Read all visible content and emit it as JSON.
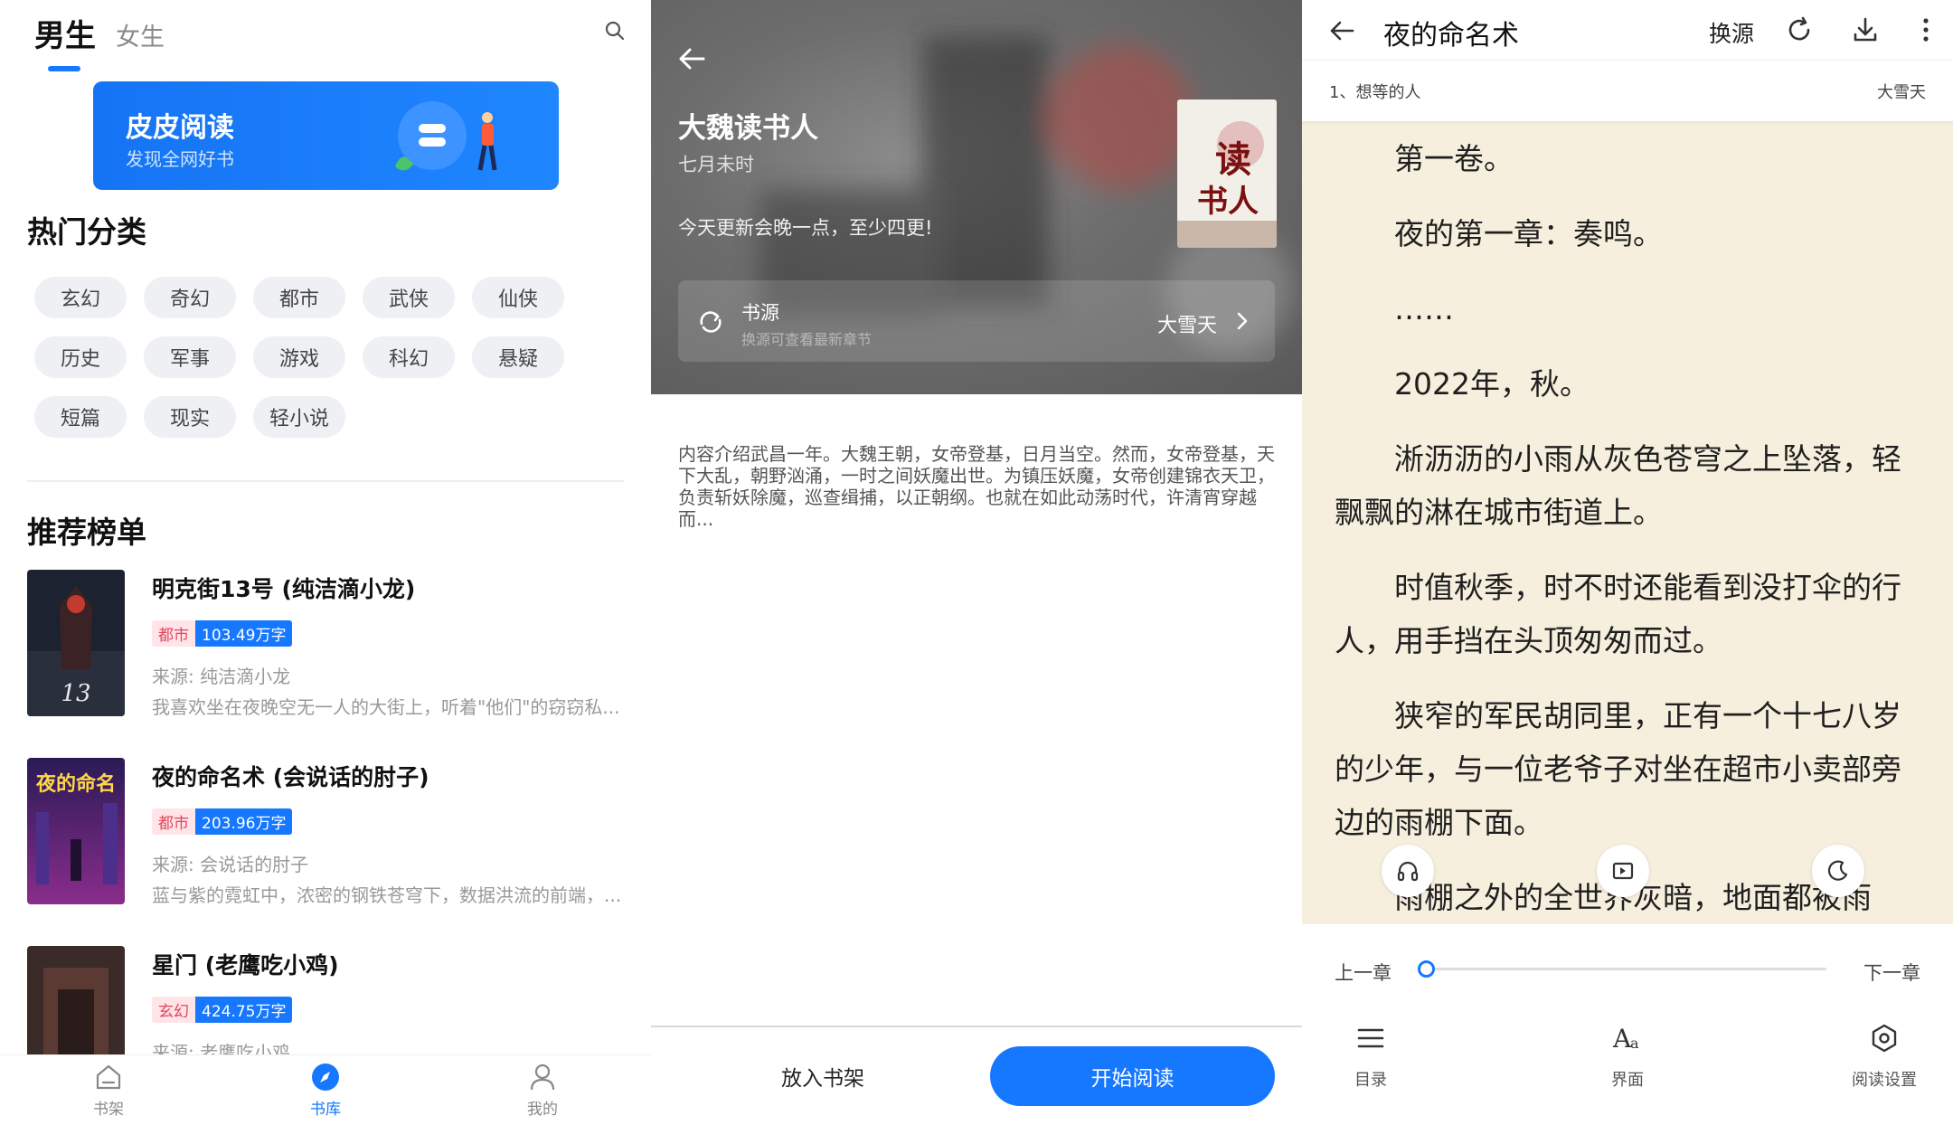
{
  "panel1": {
    "tabs": [
      "男生",
      "女生"
    ],
    "banner": {
      "title": "皮皮阅读",
      "subtitle": "发现全网好书"
    },
    "hot_title": "热门分类",
    "categories": [
      "玄幻",
      "奇幻",
      "都市",
      "武侠",
      "仙侠",
      "历史",
      "军事",
      "游戏",
      "科幻",
      "悬疑",
      "短篇",
      "现实",
      "轻小说"
    ],
    "rank_title": "推荐榜单",
    "books": [
      {
        "title": "明克街13号 (纯洁滴小龙)",
        "category": "都市",
        "length": "103.49万字",
        "source": "来源: 纯洁滴小龙",
        "desc": "我喜欢坐在夜晚空无一人的大街上，听着\"他们\"的窃窃私..."
      },
      {
        "title": "夜的命名术 (会说话的肘子)",
        "category": "都市",
        "length": "203.96万字",
        "source": "来源: 会说话的肘子",
        "desc": "蓝与紫的霓虹中，浓密的钢铁苍穹下，数据洪流的前端，..."
      },
      {
        "title": "星门 (老鹰吃小鸡)",
        "category": "玄幻",
        "length": "424.75万字",
        "source": "来源: 老鹰吃小鸡",
        "desc": ""
      }
    ],
    "nav": [
      "书架",
      "书库",
      "我的"
    ],
    "active_nav": "书库"
  },
  "panel2": {
    "book_title": "大魏读书人",
    "author": "七月未时",
    "notice": "今天更新会晚一点，至少四更!",
    "source_label": "书源",
    "source_hint": "换源可查看最新章节",
    "source_value": "大雪天",
    "intro": "内容介绍武昌一年。大魏王朝，女帝登基，日月当空。然而，女帝登基，天下大乱，朝野汹涌，一时之间妖魔出世。为镇压妖魔，女帝创建锦衣天卫，负责斩妖除魔，巡查缉捕，以正朝纲。也就在如此动荡时代，许清宵穿越而...",
    "shelf_button": "放入书架",
    "read_button": "开始阅读"
  },
  "panel3": {
    "title": "夜的命名术",
    "swap_label": "换源",
    "chapter": "1、想等的人",
    "source": "大雪天",
    "paragraphs": [
      "第一卷。",
      "夜的第一章：奏鸣。",
      "……",
      "2022年，秋。",
      "淅沥沥的小雨从灰色苍穹之上坠落，轻飘飘的淋在城市街道上。",
      "时值秋季，时不时还能看到没打伞的行人，用手挡在头顶匆匆而过。",
      "狭窄的军民胡同里，正有一个十七八岁的少年，与一位老爷子对坐在超市小卖部旁边的雨棚下面。",
      "雨棚之外的全世界灰暗，地面都被雨"
    ],
    "prev_chapter": "上一章",
    "next_chapter": "下一章",
    "progress": 0.0,
    "tools": [
      "目录",
      "界面",
      "阅读设置"
    ]
  },
  "colors": {
    "accent": "#1677ff",
    "reader_bg": "#f6efdd",
    "tag_cat_bg": "#ffe4e8",
    "tag_cat_fg": "#e2455c"
  }
}
